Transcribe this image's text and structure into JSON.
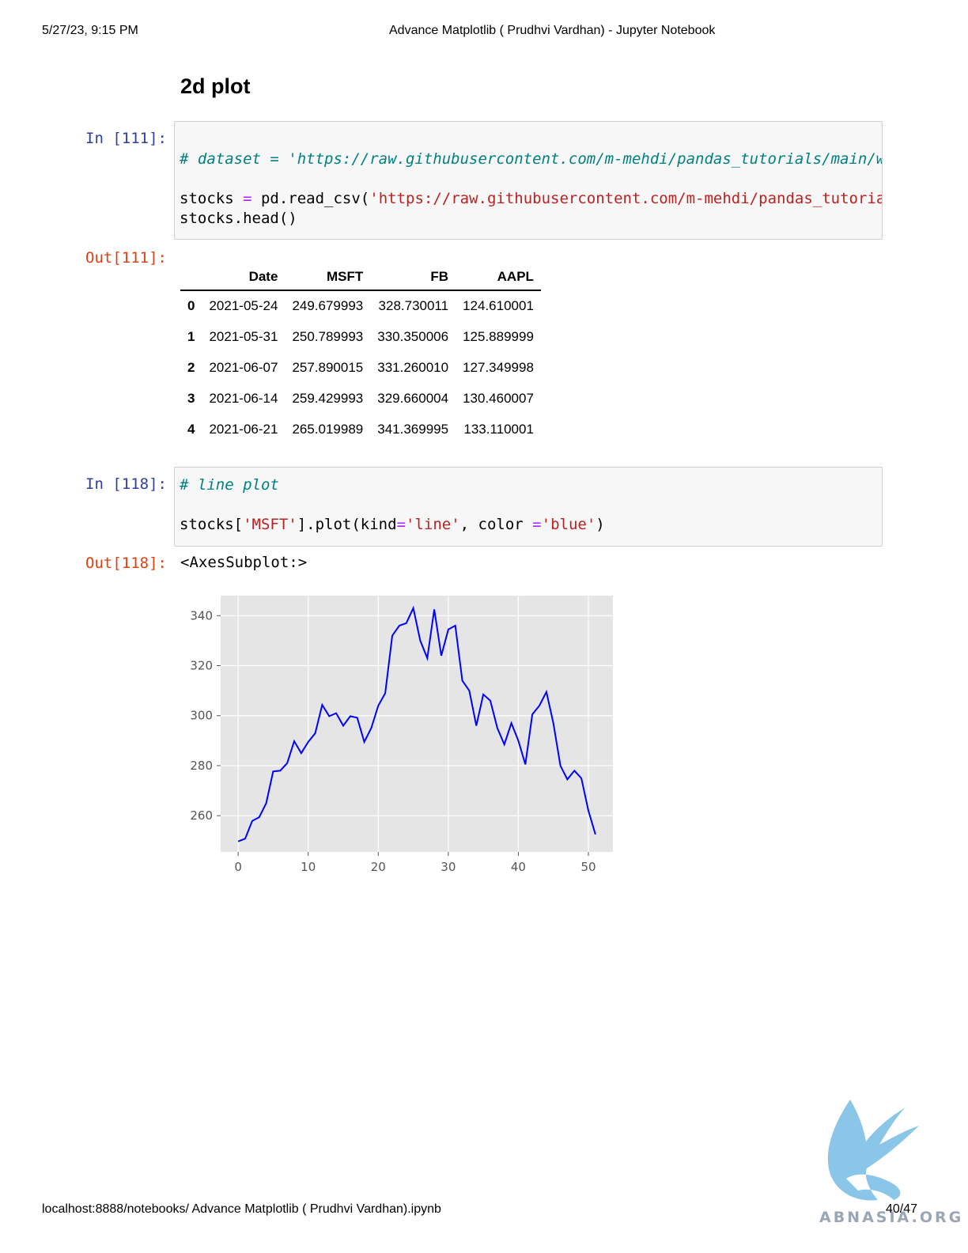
{
  "header": {
    "datetime": "5/27/23, 9:15 PM",
    "title": "Advance Matplotlib ( Prudhvi Vardhan) - Jupyter Notebook"
  },
  "footer": {
    "url": "localhost:8888/notebooks/ Advance Matplotlib ( Prudhvi Vardhan).ipynb",
    "page": "40/47"
  },
  "section_title": "2d plot",
  "cells": [
    {
      "in_prompt": "In [111]:",
      "code": {
        "comment": "# dataset = 'https://raw.githubusercontent.com/m-mehdi/pandas_tutorials/main/w",
        "var": "stocks ",
        "assign": "=",
        "call": " pd.read_csv(",
        "arg": "'https://raw.githubusercontent.com/m-mehdi/pandas_tutoria",
        "line3": "stocks.head()"
      },
      "out_prompt": "Out[111]:"
    },
    {
      "in_prompt": "In [118]:",
      "code": {
        "comment": "# line plot",
        "p1": "stocks[",
        "s1": "'MSFT'",
        "p2": "].plot(kind",
        "op1": "=",
        "s2": "'line'",
        "p3": ", color ",
        "op2": "=",
        "s3": "'blue'",
        "p4": ")"
      },
      "out_prompt": "Out[118]:",
      "out_text": "<AxesSubplot:>"
    }
  ],
  "dataframe": {
    "columns": [
      "Date",
      "MSFT",
      "FB",
      "AAPL"
    ],
    "rows": [
      {
        "index": "0",
        "Date": "2021-05-24",
        "MSFT": "249.679993",
        "FB": "328.730011",
        "AAPL": "124.610001"
      },
      {
        "index": "1",
        "Date": "2021-05-31",
        "MSFT": "250.789993",
        "FB": "330.350006",
        "AAPL": "125.889999"
      },
      {
        "index": "2",
        "Date": "2021-06-07",
        "MSFT": "257.890015",
        "FB": "331.260010",
        "AAPL": "127.349998"
      },
      {
        "index": "3",
        "Date": "2021-06-14",
        "MSFT": "259.429993",
        "FB": "329.660004",
        "AAPL": "130.460007"
      },
      {
        "index": "4",
        "Date": "2021-06-21",
        "MSFT": "265.019989",
        "FB": "341.369995",
        "AAPL": "133.110001"
      }
    ]
  },
  "chart_data": {
    "type": "line",
    "title": "",
    "xlabel": "",
    "ylabel": "",
    "xlim": [
      -2.5,
      53.5
    ],
    "ylim": [
      245.5,
      348
    ],
    "xticks": [
      0,
      10,
      20,
      30,
      40,
      50
    ],
    "yticks": [
      260,
      280,
      300,
      320,
      340
    ],
    "grid": true,
    "background": "#e5e5e5",
    "series": [
      {
        "color": "#0000ff",
        "x": [
          0,
          1,
          2,
          3,
          4,
          5,
          6,
          7,
          8,
          9,
          10,
          11,
          12,
          13,
          14,
          15,
          16,
          17,
          18,
          19,
          20,
          21,
          22,
          23,
          24,
          25,
          26,
          27,
          28,
          29,
          30,
          31,
          32,
          33,
          34,
          35,
          36,
          37,
          38,
          39,
          40,
          41,
          42,
          43,
          44,
          45,
          46,
          47,
          48,
          49,
          50,
          51
        ],
        "y": [
          249.7,
          250.8,
          257.9,
          259.4,
          265.0,
          277.7,
          278.0,
          281.0,
          289.8,
          285.0,
          289.5,
          293.0,
          304.3,
          299.8,
          301.0,
          296.0,
          299.8,
          299.2,
          289.5,
          295.0,
          304.0,
          309.0,
          332.0,
          336.0,
          337.0,
          343.0,
          330.0,
          323.0,
          342.5,
          324.0,
          334.5,
          336.0,
          314.0,
          310.0,
          296.0,
          308.5,
          306.0,
          295.0,
          288.5,
          297.0,
          290.0,
          280.5,
          300.5,
          304.0,
          309.5,
          297.0,
          280.0,
          274.5,
          278.0,
          275.0,
          262.0,
          252.5
        ]
      }
    ]
  },
  "logo": {
    "text": "ABNASIA.ORG",
    "color": "#8ac6e8"
  }
}
